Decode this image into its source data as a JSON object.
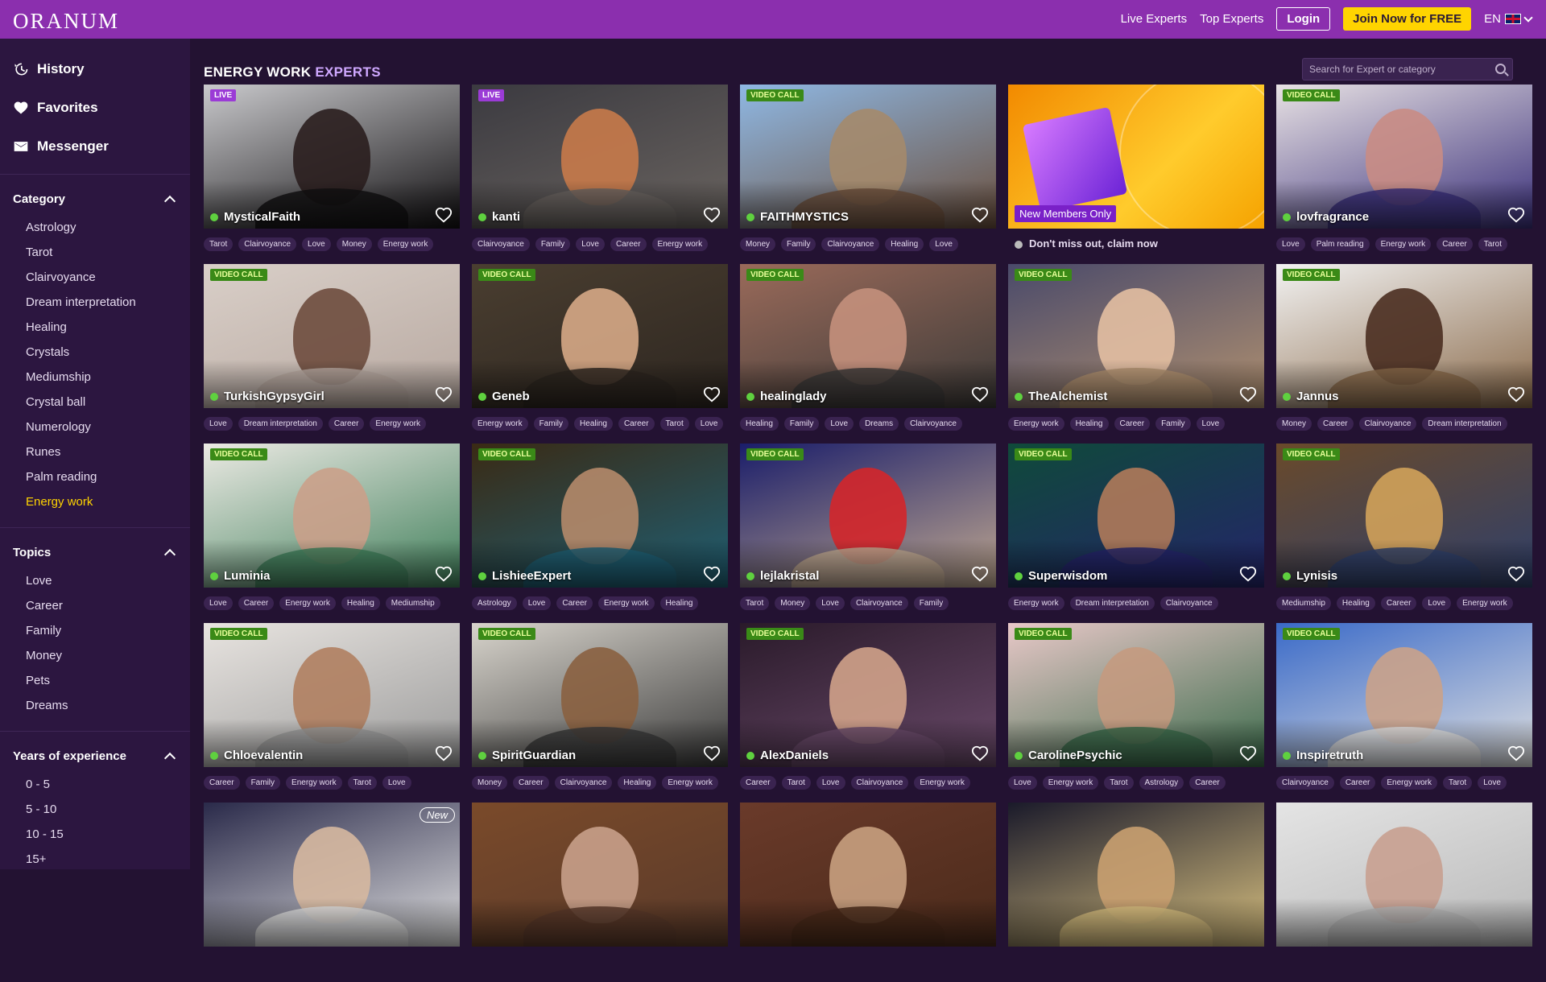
{
  "header": {
    "logo": "ORANUM",
    "links": [
      "Live Experts",
      "Top Experts"
    ],
    "login": "Login",
    "join": "Join Now for FREE",
    "lang": "EN"
  },
  "sidebar": {
    "nav": [
      {
        "label": "History",
        "icon": "history-icon"
      },
      {
        "label": "Favorites",
        "icon": "heart-icon"
      },
      {
        "label": "Messenger",
        "icon": "envelope-icon"
      }
    ],
    "category": {
      "title": "Category",
      "items": [
        "Astrology",
        "Tarot",
        "Clairvoyance",
        "Dream interpretation",
        "Healing",
        "Crystals",
        "Mediumship",
        "Crystal ball",
        "Numerology",
        "Runes",
        "Palm reading",
        "Energy work"
      ],
      "active": "Energy work"
    },
    "topics": {
      "title": "Topics",
      "items": [
        "Love",
        "Career",
        "Family",
        "Money",
        "Pets",
        "Dreams"
      ]
    },
    "years": {
      "title": "Years of experience",
      "items": [
        "0 - 5",
        "5 - 10",
        "10 - 15",
        "15+"
      ]
    }
  },
  "main": {
    "title_a": "ENERGY WORK",
    "title_b": "EXPERTS",
    "search_placeholder": "Search for Expert or category",
    "promo": {
      "label": "New Members Only",
      "note": "Don't miss out, claim now"
    },
    "new_badge": "New",
    "cards": [
      {
        "name": "MysticalFaith",
        "badge": "LIVE",
        "tags": [
          "Tarot",
          "Clairvoyance",
          "Love",
          "Money",
          "Energy work"
        ],
        "colors": [
          "#c9c9cc",
          "#2a1e1e",
          "#121012"
        ]
      },
      {
        "name": "kanti",
        "badge": "LIVE",
        "tags": [
          "Clairvoyance",
          "Family",
          "Love",
          "Career",
          "Energy work"
        ],
        "colors": [
          "#3b3a40",
          "#c87a4a",
          "#6a6460"
        ]
      },
      {
        "name": "FAITHMYSTICS",
        "badge": "VIDEO CALL",
        "tags": [
          "Money",
          "Family",
          "Clairvoyance",
          "Healing",
          "Love"
        ],
        "colors": [
          "#8fb8e4",
          "#a48a6c",
          "#6b4f3c"
        ]
      },
      {
        "promo": true
      },
      {
        "name": "lovfragrance",
        "badge": "VIDEO CALL",
        "tags": [
          "Love",
          "Palm reading",
          "Energy work",
          "Career",
          "Tarot"
        ],
        "colors": [
          "#e8e2e4",
          "#c98c84",
          "#3a2f7a"
        ]
      },
      {
        "name": "TurkishGypsyGirl",
        "badge": "VIDEO CALL",
        "tags": [
          "Love",
          "Dream interpretation",
          "Career",
          "Energy work"
        ],
        "colors": [
          "#d9cfc8",
          "#6e4c3e",
          "#b7a8a0"
        ]
      },
      {
        "name": "Geneb",
        "badge": "VIDEO CALL",
        "tags": [
          "Energy work",
          "Family",
          "Healing",
          "Career",
          "Tarot",
          "Love"
        ],
        "colors": [
          "#4a3e30",
          "#d6a886",
          "#2d2620"
        ]
      },
      {
        "name": "healinglady",
        "badge": "VIDEO CALL",
        "tags": [
          "Healing",
          "Family",
          "Love",
          "Dreams",
          "Clairvoyance"
        ],
        "colors": [
          "#9a6a5a",
          "#c4907c",
          "#3c3a38"
        ]
      },
      {
        "name": "TheAlchemist",
        "badge": "VIDEO CALL",
        "tags": [
          "Energy work",
          "Healing",
          "Career",
          "Family",
          "Love"
        ],
        "colors": [
          "#4a4a6a",
          "#e3bfa2",
          "#b09070"
        ]
      },
      {
        "name": "Jannus",
        "badge": "VIDEO CALL",
        "tags": [
          "Money",
          "Career",
          "Clairvoyance",
          "Dream interpretation"
        ],
        "colors": [
          "#f2f2f2",
          "#4a2d20",
          "#8a6a4a"
        ]
      },
      {
        "name": "Luminia",
        "badge": "VIDEO CALL",
        "tags": [
          "Love",
          "Career",
          "Energy work",
          "Healing",
          "Mediumship"
        ],
        "colors": [
          "#eceae4",
          "#caa08a",
          "#3f7f5a"
        ]
      },
      {
        "name": "LishieeExpert",
        "badge": "VIDEO CALL",
        "tags": [
          "Astrology",
          "Love",
          "Career",
          "Energy work",
          "Healing"
        ],
        "colors": [
          "#3a2a14",
          "#b58a6a",
          "#1f5f74"
        ]
      },
      {
        "name": "lejlakristal",
        "badge": "VIDEO CALL",
        "tags": [
          "Tarot",
          "Money",
          "Love",
          "Clairvoyance",
          "Family"
        ],
        "colors": [
          "#1a1d6a",
          "#d4262a",
          "#c0a890"
        ]
      },
      {
        "name": "Superwisdom",
        "badge": "VIDEO CALL",
        "tags": [
          "Energy work",
          "Dream interpretation",
          "Clairvoyance"
        ],
        "colors": [
          "#0f4a3a",
          "#b07a5a",
          "#24246a"
        ]
      },
      {
        "name": "Lynisis",
        "badge": "VIDEO CALL",
        "tags": [
          "Mediumship",
          "Healing",
          "Career",
          "Love",
          "Energy work"
        ],
        "colors": [
          "#6a4a2a",
          "#d2a25a",
          "#2f3f6a"
        ]
      },
      {
        "name": "Chloevalentin",
        "badge": "VIDEO CALL",
        "tags": [
          "Career",
          "Family",
          "Energy work",
          "Tarot",
          "Love"
        ],
        "colors": [
          "#e8e4e0",
          "#b08060",
          "#9a9a9a"
        ]
      },
      {
        "name": "SpiritGuardian",
        "badge": "VIDEO CALL",
        "tags": [
          "Money",
          "Career",
          "Clairvoyance",
          "Healing",
          "Energy work"
        ],
        "colors": [
          "#d8d4cc",
          "#8a6040",
          "#3a3a3a"
        ]
      },
      {
        "name": "AlexDaniels",
        "badge": "VIDEO CALL",
        "tags": [
          "Career",
          "Tarot",
          "Love",
          "Clairvoyance",
          "Energy work"
        ],
        "colors": [
          "#2a1a2a",
          "#d0a28a",
          "#6a4a6a"
        ]
      },
      {
        "name": "CarolinePsychic",
        "badge": "VIDEO CALL",
        "tags": [
          "Love",
          "Energy work",
          "Tarot",
          "Astrology",
          "Career"
        ],
        "colors": [
          "#e8c8c8",
          "#c49a80",
          "#3a6a4a"
        ]
      },
      {
        "name": "Inspiretruth",
        "badge": "VIDEO CALL",
        "tags": [
          "Clairvoyance",
          "Career",
          "Energy work",
          "Tarot",
          "Love"
        ],
        "colors": [
          "#3a6ac8",
          "#caa28a",
          "#e0e0e0"
        ]
      },
      {
        "name": "",
        "badge": "",
        "new": true,
        "tags": [],
        "colors": [
          "#2a2a4a",
          "#d6b8a0",
          "#e0e0e0"
        ]
      },
      {
        "name": "",
        "badge": "",
        "tags": [],
        "colors": [
          "#7a4a2a",
          "#c8a08a",
          "#5a3a2a"
        ]
      },
      {
        "name": "",
        "badge": "",
        "tags": [],
        "colors": [
          "#6a3a2a",
          "#c8a080",
          "#4a2a1a"
        ]
      },
      {
        "name": "",
        "badge": "",
        "tags": [],
        "colors": [
          "#1a1a2a",
          "#c9a070",
          "#d8c080"
        ]
      },
      {
        "name": "",
        "badge": "",
        "tags": [],
        "colors": [
          "#e4e4e4",
          "#c8a090",
          "#b8b8b8"
        ]
      }
    ]
  },
  "colors": {
    "header": "#8b2fae",
    "sidebar": "#2c1640",
    "background": "#231232",
    "accent": "#ffd400",
    "online": "#5fd13f"
  }
}
